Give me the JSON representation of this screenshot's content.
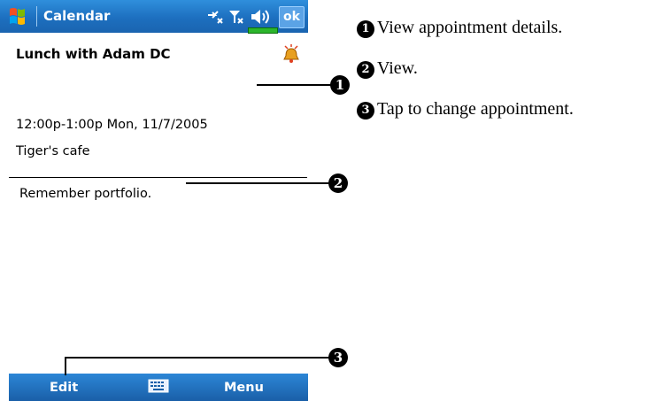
{
  "titlebar": {
    "app_title": "Calendar",
    "ok_label": "ok"
  },
  "appointment": {
    "subject": "Lunch with Adam DC",
    "time": "12:00p-1:00p Mon, 11/7/2005",
    "location": "Tiger's cafe",
    "notes": "Remember portfolio."
  },
  "menubar": {
    "edit_label": "Edit",
    "menu_label": "Menu"
  },
  "callouts": [
    {
      "marker": "1",
      "text": "View appointment details."
    },
    {
      "marker": "2",
      "text": "View."
    },
    {
      "marker": "3",
      "text": "Tap to change appointment."
    }
  ],
  "icons": [
    "windows-start-icon",
    "connectivity-icon",
    "signal-icon",
    "speaker-icon",
    "battery-icon",
    "alarm-bell-icon",
    "keyboard-icon"
  ],
  "colors": {
    "titlebar": "#1d6fbf",
    "menubar": "#1a5fa8",
    "battery": "#2cb52c"
  }
}
